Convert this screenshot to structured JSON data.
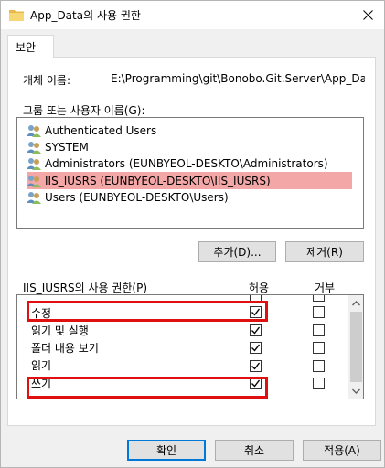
{
  "window": {
    "title": "App_Data의 사용 권한",
    "close_icon": "close-icon"
  },
  "tabs": [
    {
      "label": "보안"
    }
  ],
  "object": {
    "label": "개체 이름:",
    "value": "E:\\Programming\\git\\Bonobo.Git.Server\\App_Data"
  },
  "groups": {
    "label": "그룹 또는 사용자 이름(G):",
    "items": [
      {
        "label": "Authenticated Users",
        "icon": "users-icon"
      },
      {
        "label": "SYSTEM",
        "icon": "users-icon"
      },
      {
        "label": "Administrators (EUNBYEOL-DESKTO\\Administrators)",
        "icon": "users-icon"
      },
      {
        "label": "IIS_IUSRS (EUNBYEOL-DESKTO\\IIS_IUSRS)",
        "icon": "users-icon",
        "selected": true
      },
      {
        "label": "Users (EUNBYEOL-DESKTO\\Users)",
        "icon": "users-icon"
      }
    ],
    "add_button": "추가(D)...",
    "remove_button": "제거(R)"
  },
  "permissions": {
    "label": "IIS_IUSRS의 사용 권한(P)",
    "allow_header": "허용",
    "deny_header": "거부",
    "rows": [
      {
        "label": "수정",
        "allow": true,
        "deny": false,
        "highlighted": true
      },
      {
        "label": "읽기 및 실행",
        "allow": true,
        "deny": false
      },
      {
        "label": "폴더 내용 보기",
        "allow": true,
        "deny": false
      },
      {
        "label": "읽기",
        "allow": true,
        "deny": false
      },
      {
        "label": "쓰기",
        "allow": true,
        "deny": false,
        "highlighted": true
      }
    ]
  },
  "footer": {
    "ok": "확인",
    "cancel": "취소",
    "apply": "적용(A)"
  },
  "colors": {
    "selection": "#f4a7a7",
    "highlight_box": "#e01010",
    "primary_border": "#0078d7"
  }
}
